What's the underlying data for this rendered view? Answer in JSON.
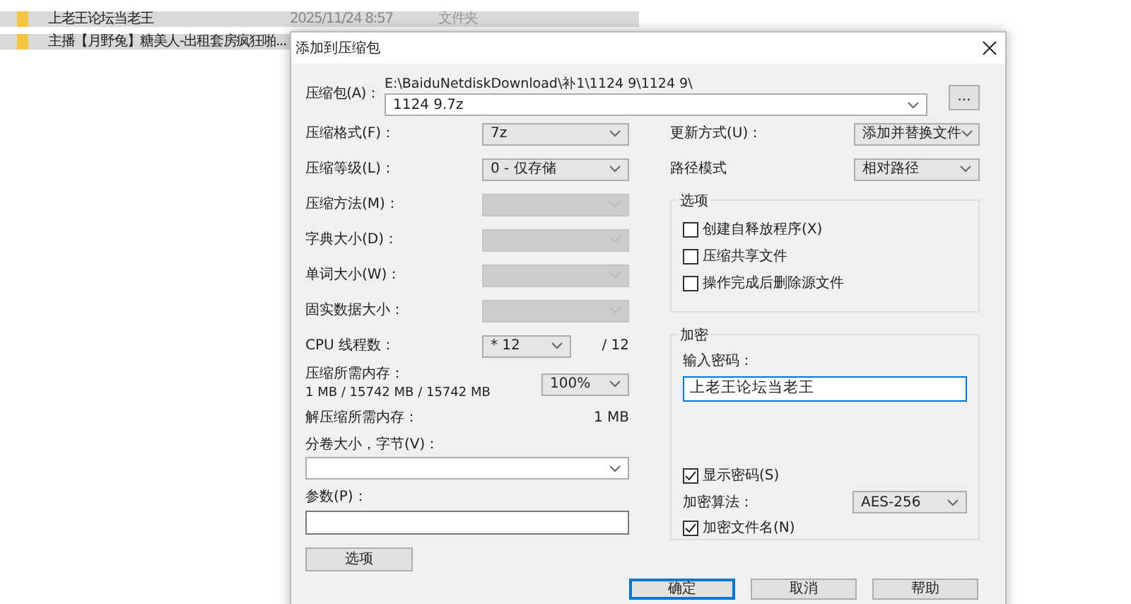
{
  "file_list": {
    "rows": [
      {
        "name": "上老王论坛当老王",
        "date": "2025/11/24 8:57",
        "type": "文件夹",
        "selected": true
      },
      {
        "name": "主播【月野兔】糖美人-出租套房疯狂啪...",
        "selected": true
      }
    ]
  },
  "dialog": {
    "title": "添加到压缩包",
    "archive": {
      "label": "压缩包(A)：",
      "path": "E:\\BaiduNetdiskDownload\\补1\\1124 9\\1124 9\\",
      "value": "1124 9.7z"
    },
    "browse_button": "...",
    "left_fields": [
      {
        "label": "压缩格式(F)：",
        "value": "7z",
        "disabled": false
      },
      {
        "label": "压缩等级(L)：",
        "value": "0 - 仅存储",
        "disabled": false
      },
      {
        "label": "压缩方法(M)：",
        "disabled": true
      },
      {
        "label": "字典大小(D)：",
        "disabled": true
      },
      {
        "label": "单词大小(W)：",
        "disabled": true
      },
      {
        "label": "固实数据大小：",
        "disabled": true
      }
    ],
    "cpu": {
      "label": "CPU 线程数：",
      "value": "* 12",
      "max": "/ 12"
    },
    "memory": {
      "label": "压缩所需内存：",
      "value": "1 MB / 15742 MB / 15742 MB",
      "select_value": "100%"
    },
    "decompress": {
      "label": "解压缩所需内存：",
      "value": "1 MB"
    },
    "volume": {
      "label": "分卷大小，字节(V)："
    },
    "params": {
      "label": "参数(P)："
    },
    "options_button": "选项",
    "update": {
      "label": "更新方式(U)：",
      "value": "添加并替换文件"
    },
    "path_mode": {
      "label": "路径模式",
      "value": "相对路径"
    },
    "options_group": {
      "title": "选项",
      "checkboxes": [
        {
          "label": "创建自释放程序(X)",
          "checked": false
        },
        {
          "label": "压缩共享文件",
          "checked": false
        },
        {
          "label": "操作完成后删除源文件",
          "checked": false
        }
      ]
    },
    "encryption": {
      "title": "加密",
      "password_label": "输入密码：",
      "password_value": "上老王论坛当老王",
      "show_password": {
        "label": "显示密码(S)",
        "checked": true
      },
      "method": {
        "label": "加密算法：",
        "value": "AES-256"
      },
      "encrypt_names": {
        "label": "加密文件名(N)",
        "checked": true
      }
    },
    "buttons": [
      {
        "label": "确定",
        "default": true
      },
      {
        "label": "取消",
        "default": false
      },
      {
        "label": "帮助",
        "default": false
      }
    ]
  }
}
